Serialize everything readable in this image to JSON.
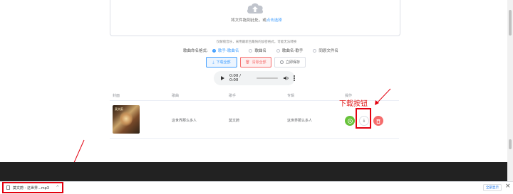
{
  "upload": {
    "hint_prefix": "将文件拖到此处，或",
    "hint_link": "点击选择",
    "notice": "仅解锁音乐，采用最新且最快的加密格式，可能无法转换"
  },
  "naming": {
    "label": "歌曲命名格式:",
    "options": [
      "歌手-歌曲名",
      "歌曲名",
      "歌曲名-歌手",
      "同原文件名"
    ],
    "selected": "歌手-歌曲名"
  },
  "actions": {
    "download_all": "下载全部",
    "clear_all": "清除全部",
    "save_now": "立即保存"
  },
  "player": {
    "time": "0:00 / 0:00"
  },
  "table": {
    "headers": [
      "封面",
      "歌曲",
      "歌手",
      "专辑",
      "操作"
    ],
    "rows": [
      {
        "song": "这世界那么多人",
        "artist": "莫文蔚",
        "album": "这世界那么多人",
        "cover_text": "莫文蔚"
      }
    ]
  },
  "annotation": {
    "label": "下载按钮"
  },
  "download_shelf": {
    "item": "莫文蔚 - 这世界...mp3",
    "show_all": "全部显示"
  },
  "colors": {
    "primary": "#409eff",
    "danger": "#f56c6c",
    "success": "#67c23a",
    "annotation_red": "#e3000f"
  }
}
